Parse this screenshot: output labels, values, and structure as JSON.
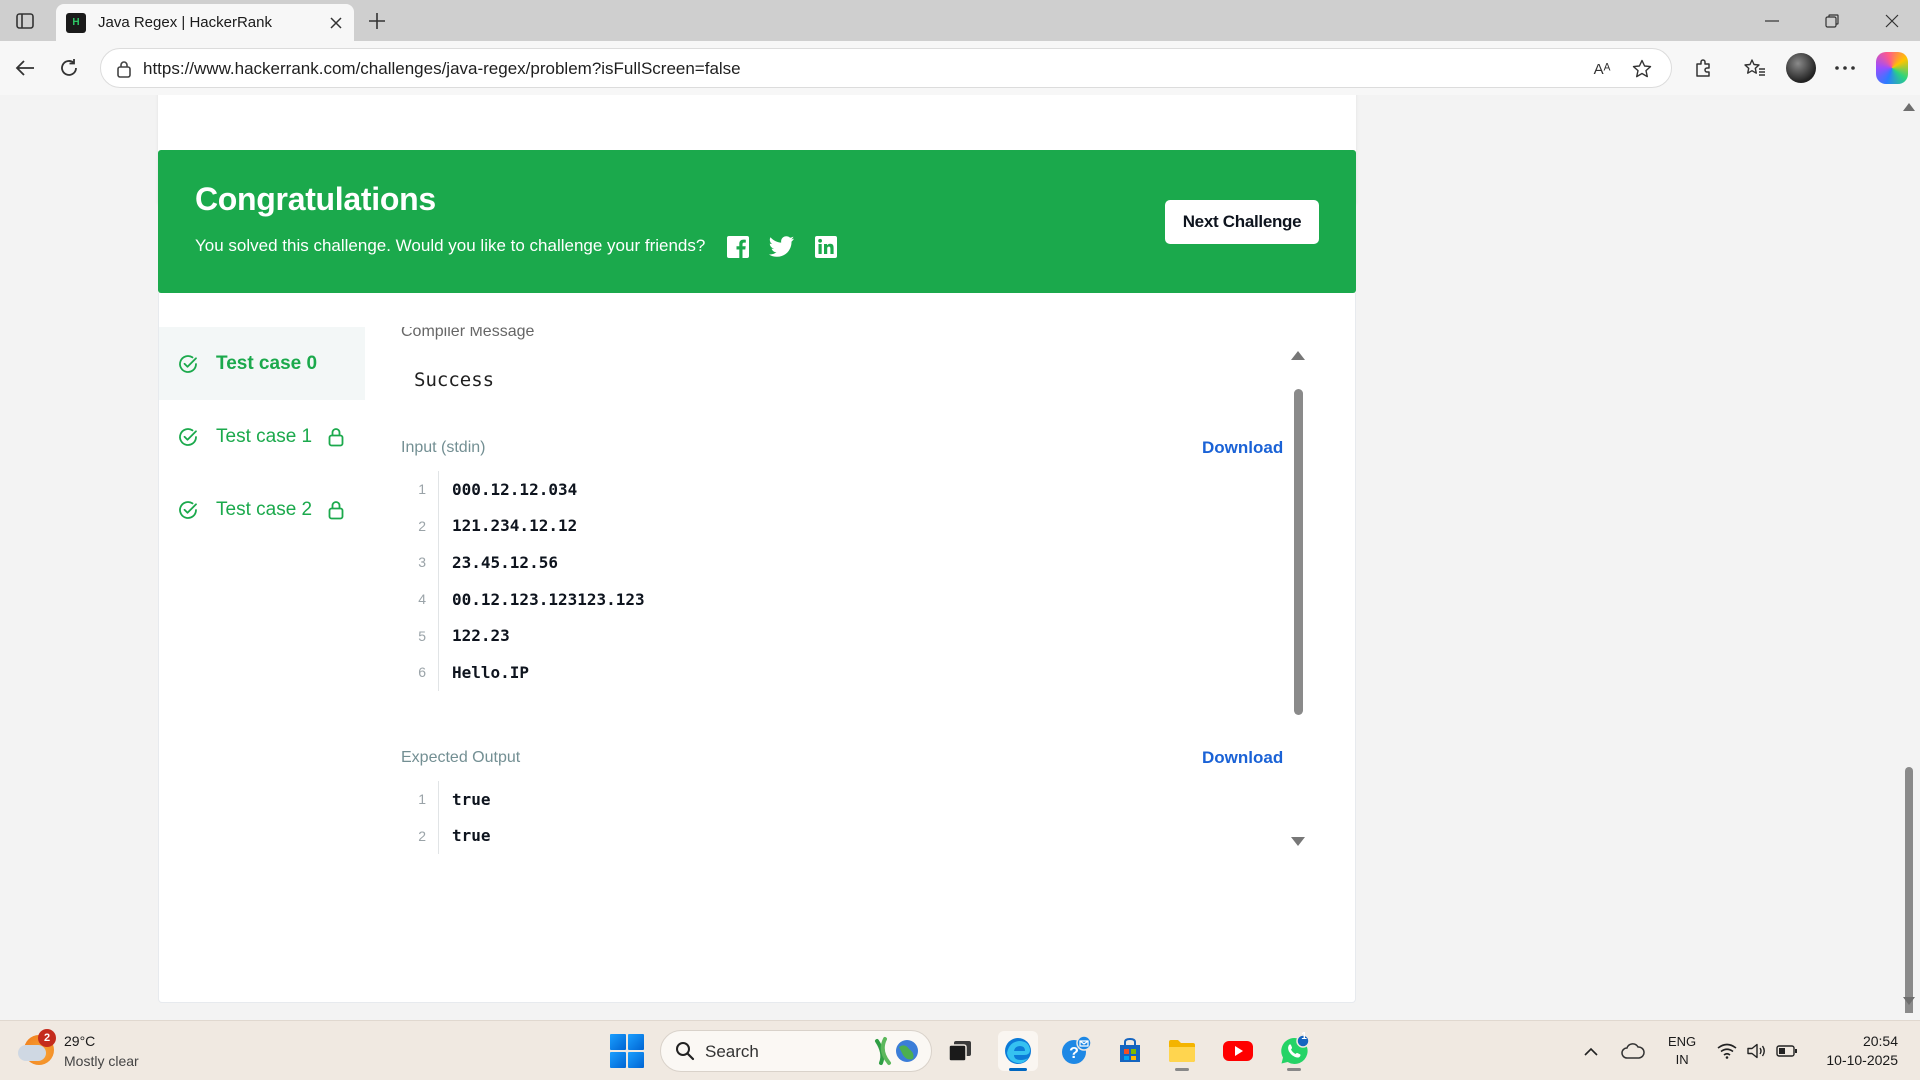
{
  "browser": {
    "tab_title": "Java Regex | HackerRank",
    "tab_favicon_text": "H",
    "url": "https://www.hackerrank.com/challenges/java-regex/problem?isFullScreen=false",
    "read_aloud_label": "Aᴬ"
  },
  "banner": {
    "title": "Congratulations",
    "subtitle": "You solved this challenge. Would you like to challenge your friends?",
    "next_button": "Next Challenge",
    "color": "#1ba94c"
  },
  "test_cases": [
    {
      "label": "Test case 0",
      "locked": false,
      "active": true
    },
    {
      "label": "Test case 1",
      "locked": true,
      "active": false
    },
    {
      "label": "Test case 2",
      "locked": true,
      "active": false
    }
  ],
  "output": {
    "compiler_heading": "Compiler Message",
    "compiler_message": "Success",
    "input_label": "Input (stdin)",
    "download_label": "Download",
    "input_lines": [
      {
        "num": "1",
        "text": "000.12.12.034"
      },
      {
        "num": "2",
        "text": "121.234.12.12"
      },
      {
        "num": "3",
        "text": "23.45.12.56"
      },
      {
        "num": "4",
        "text": "00.12.123.123123.123"
      },
      {
        "num": "5",
        "text": "122.23"
      },
      {
        "num": "6",
        "text": "Hello.IP"
      }
    ],
    "expected_label": "Expected Output",
    "expected_lines": [
      {
        "num": "1",
        "text": "true"
      },
      {
        "num": "2",
        "text": "true"
      }
    ]
  },
  "taskbar": {
    "weather_badge": "2",
    "weather_temp": "29°C",
    "weather_desc": "Mostly clear",
    "search_placeholder": "Search",
    "mail_badge": "1",
    "lang_line1": "ENG",
    "lang_line2": "IN",
    "time": "20:54",
    "date": "10-10-2025"
  }
}
